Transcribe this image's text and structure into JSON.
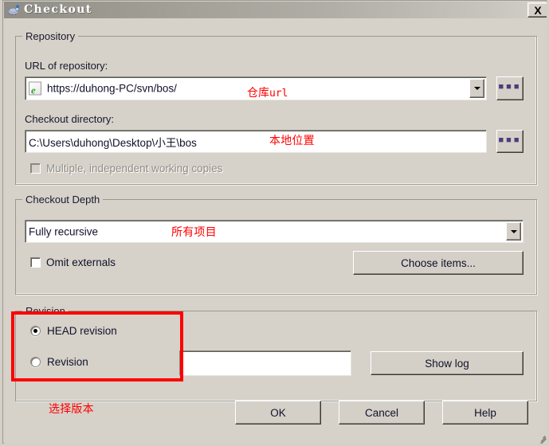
{
  "window": {
    "title": "Checkout",
    "icon": "tortoise-svn-icon",
    "close_label": "X"
  },
  "repository_group": {
    "legend": "Repository",
    "url_label": "URL of repository:",
    "url_value": "https://duhong-PC/svn/bos/",
    "url_icon": "web-document-icon",
    "url_browse_label": "...",
    "directory_label": "Checkout directory:",
    "directory_value": "C:\\Users\\duhong\\Desktop\\小王\\bos",
    "directory_browse_label": "...",
    "multiple_copies_label": "Multiple, independent working copies",
    "multiple_copies_checked": false,
    "multiple_copies_enabled": false
  },
  "depth_group": {
    "legend": "Checkout Depth",
    "depth_value": "Fully recursive",
    "omit_externals_label": "Omit externals",
    "omit_externals_checked": false,
    "choose_items_label": "Choose items..."
  },
  "revision_group": {
    "legend": "Revision",
    "head_revision_label": "HEAD revision",
    "head_revision_selected": true,
    "revision_label": "Revision",
    "revision_selected": false,
    "revision_value": "",
    "show_log_label": "Show log"
  },
  "footer": {
    "ok_label": "OK",
    "cancel_label": "Cancel",
    "help_label": "Help"
  },
  "annotations": {
    "repo_url_cn": "仓库",
    "repo_url_latin": "url",
    "local_path": "本地位置",
    "all_items": "所有项目",
    "select_version": "选择版本",
    "color": "#ff0000"
  }
}
